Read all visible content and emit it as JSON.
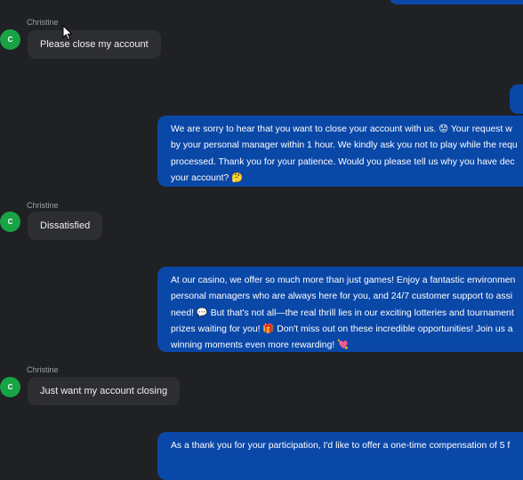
{
  "conversation": {
    "messages": [
      {
        "sender": "Christine",
        "avatar_initial": "C",
        "text": "Please close my account"
      },
      {
        "sender": "agent",
        "lines": [
          "We are sorry to hear that you want to close your account with us. 😟 Your request w",
          "by your personal manager within 1 hour. We kindly ask you not to play while the requ",
          "processed. Thank you for your patience. Would you please tell us why you have dec",
          "your account? 🤔"
        ]
      },
      {
        "sender": "Christine",
        "avatar_initial": "C",
        "text": "Dissatisfied"
      },
      {
        "sender": "agent",
        "lines": [
          "At our casino, we offer so much more than just games! Enjoy a fantastic environmen",
          "personal managers who are always here for you, and 24/7 customer support to assi",
          "need! 💬 But that's not all—the real thrill lies in our exciting lotteries and tournament",
          "prizes waiting for you! 🎁 Don't miss out on these incredible opportunities! Join us a",
          "winning moments even more rewarding! 💘"
        ]
      },
      {
        "sender": "Christine",
        "avatar_initial": "C",
        "text": "Just want my account closing"
      },
      {
        "sender": "agent",
        "lines": [
          "As a thank you for your participation, I'd like to offer a one-time compensation of 5 f"
        ]
      }
    ]
  },
  "colors": {
    "background": "#202124",
    "user_bubble": "#2d2e31",
    "agent_bubble": "#0a48a8",
    "avatar": "#18a344"
  },
  "icons": {
    "cursor": "mouse-pointer-icon"
  }
}
